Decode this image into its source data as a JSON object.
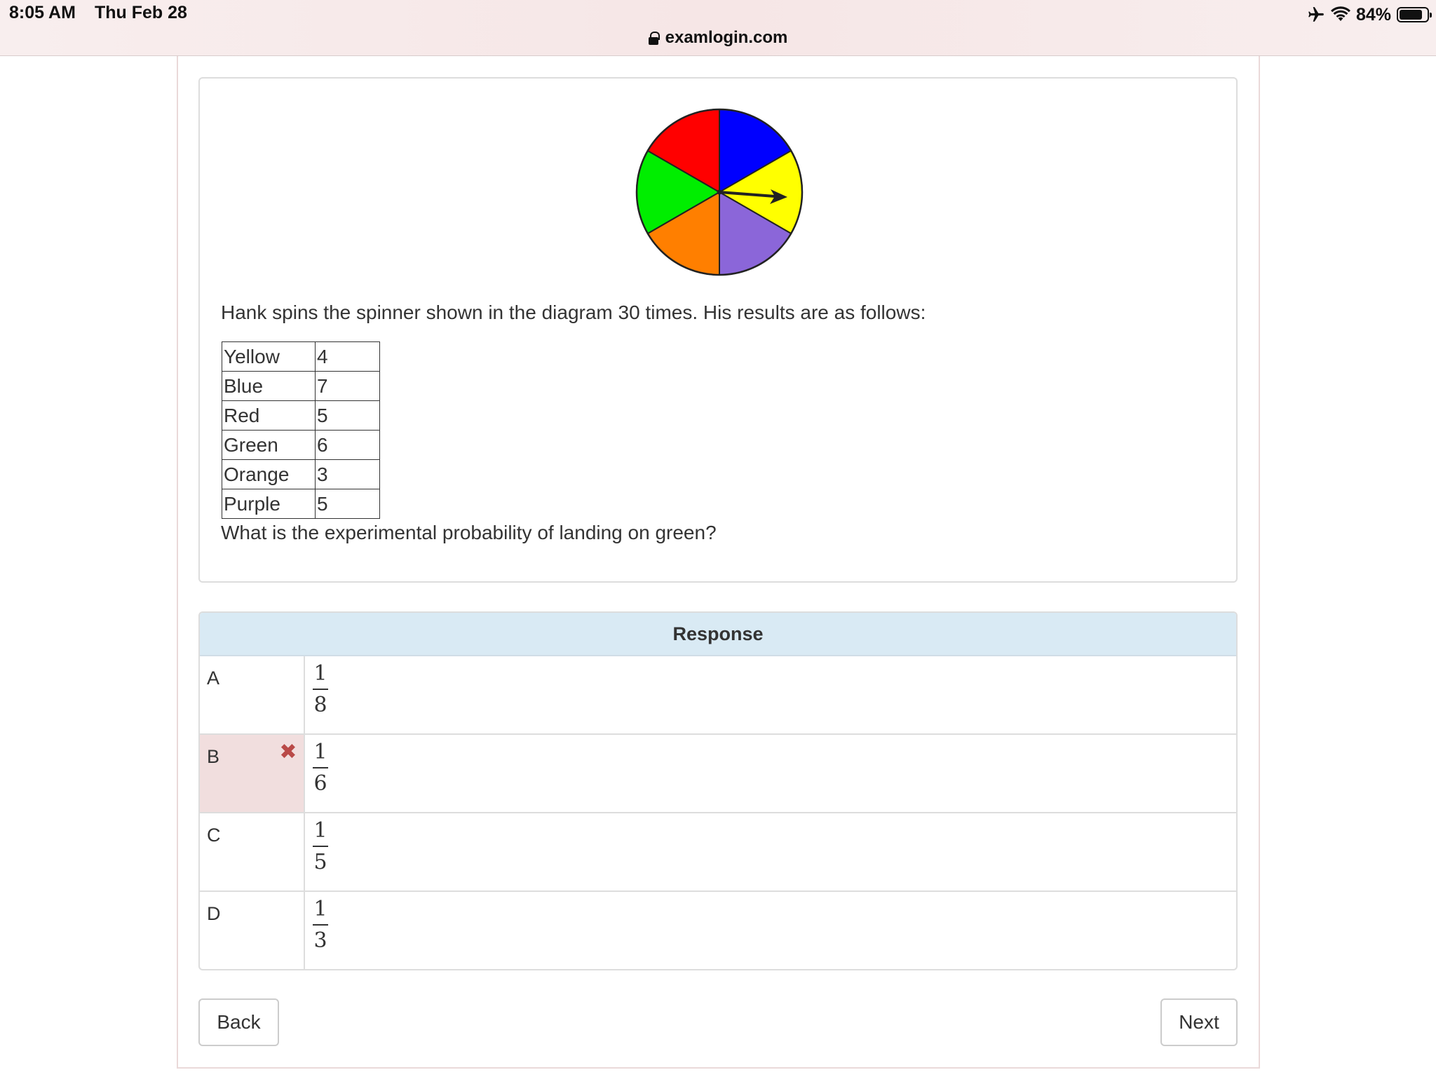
{
  "status_bar": {
    "time": "8:05 AM",
    "date": "Thu Feb 28",
    "battery_percent": "84%",
    "battery_level": 0.84,
    "icons": [
      "airplane-icon",
      "wifi-icon",
      "battery-icon"
    ]
  },
  "address_bar": {
    "url": "examlogin.com",
    "icon": "lock-icon"
  },
  "question": {
    "spinner": {
      "sector_colors": [
        "#0000ff",
        "#ffff00",
        "#8b66d9",
        "#ff7f00",
        "#00ee00",
        "#ff0000"
      ],
      "pointer": "arrow pointing to yellow"
    },
    "text": "Hank spins the spinner shown in the diagram 30 times.  His results are as follows:",
    "results": [
      {
        "color": "Yellow",
        "count": "4"
      },
      {
        "color": "Blue",
        "count": "7"
      },
      {
        "color": "Red",
        "count": "5"
      },
      {
        "color": "Green",
        "count": "6"
      },
      {
        "color": "Orange",
        "count": "3"
      },
      {
        "color": "Purple",
        "count": "5"
      }
    ],
    "prompt": "What is the experimental probability of landing on green?"
  },
  "response": {
    "header": "Response",
    "options": [
      {
        "letter": "A",
        "numerator": "1",
        "denominator": "8",
        "marked_wrong": false
      },
      {
        "letter": "B",
        "numerator": "1",
        "denominator": "6",
        "marked_wrong": true
      },
      {
        "letter": "C",
        "numerator": "1",
        "denominator": "5",
        "marked_wrong": false
      },
      {
        "letter": "D",
        "numerator": "1",
        "denominator": "3",
        "marked_wrong": false
      }
    ],
    "wrong_mark_color": "#b94a48",
    "wrong_row_color": "#f1dede",
    "header_color": "#d9eaf4"
  },
  "nav": {
    "back_label": "Back",
    "next_label": "Next"
  }
}
